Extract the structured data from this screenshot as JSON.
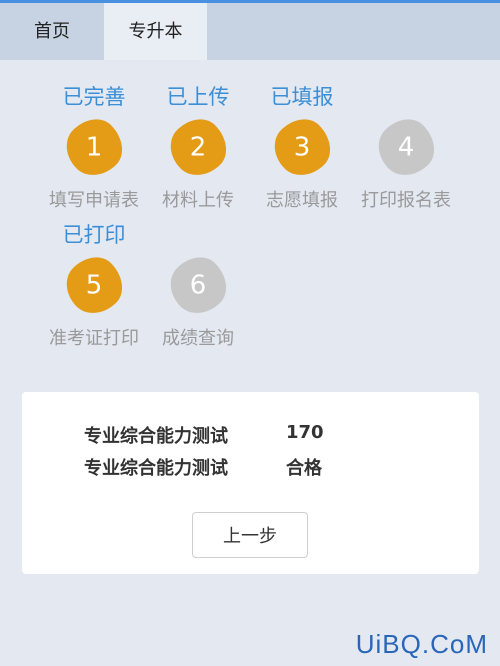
{
  "tabs": [
    {
      "label": "首页"
    },
    {
      "label": "专升本"
    }
  ],
  "steps": [
    {
      "num": "1",
      "status": "已完善",
      "label": "填写申请表"
    },
    {
      "num": "2",
      "status": "已上传",
      "label": "材料上传"
    },
    {
      "num": "3",
      "status": "已填报",
      "label": "志愿填报"
    },
    {
      "num": "4",
      "status": "",
      "label": "打印报名表"
    },
    {
      "num": "5",
      "status": "已打印",
      "label": "准考证打印"
    },
    {
      "num": "6",
      "status": "",
      "label": "成绩查询"
    }
  ],
  "scores": [
    {
      "name": "专业综合能力测试",
      "value": "170"
    },
    {
      "name": "专业综合能力测试",
      "value": "合格"
    }
  ],
  "buttons": {
    "prev": "上一步"
  },
  "watermark": "UiBQ.CoM",
  "colors": {
    "accent": "#3c8fd6",
    "step_done": "#e49b16",
    "step_pending": "#c7c7c7"
  }
}
